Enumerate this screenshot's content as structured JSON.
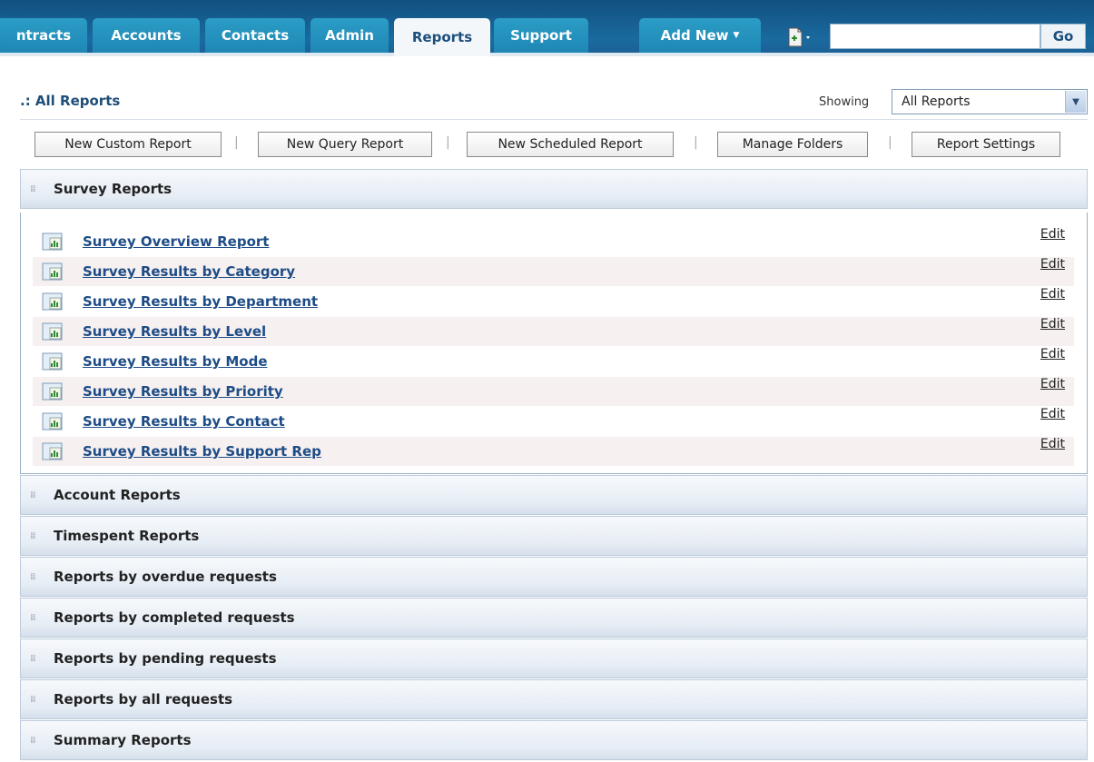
{
  "nav": {
    "tabs": [
      {
        "label": "ntracts"
      },
      {
        "label": "Accounts"
      },
      {
        "label": "Contacts"
      },
      {
        "label": "Admin"
      },
      {
        "label": "Reports",
        "active": true
      },
      {
        "label": "Support"
      }
    ],
    "add_new_label": "Add New",
    "quick_icon": "new-document-icon",
    "search_value": "",
    "go_label": "Go"
  },
  "header": {
    "title": ".: All Reports",
    "showing_label": "Showing",
    "showing_value": "All Reports"
  },
  "toolbar": {
    "buttons": [
      {
        "label": "New Custom Report"
      },
      {
        "label": "New Query Report"
      },
      {
        "label": "New Scheduled Report"
      },
      {
        "label": "Manage Folders"
      },
      {
        "label": "Report Settings"
      }
    ],
    "separator": "|"
  },
  "sections": [
    {
      "title": "Survey Reports",
      "expanded": true
    },
    {
      "title": "Account Reports"
    },
    {
      "title": "Timespent Reports"
    },
    {
      "title": "Reports by overdue requests"
    },
    {
      "title": "Reports by completed requests"
    },
    {
      "title": "Reports by pending requests"
    },
    {
      "title": "Reports by all requests"
    },
    {
      "title": "Summary Reports"
    }
  ],
  "survey_reports": [
    {
      "name": "Survey Overview Report",
      "edit": "Edit"
    },
    {
      "name": "Survey Results by Category",
      "edit": "Edit"
    },
    {
      "name": "Survey Results by Department",
      "edit": "Edit"
    },
    {
      "name": "Survey Results by Level",
      "edit": "Edit"
    },
    {
      "name": "Survey Results by Mode",
      "edit": "Edit"
    },
    {
      "name": "Survey Results by Priority",
      "edit": "Edit"
    },
    {
      "name": "Survey Results by Contact",
      "edit": "Edit"
    },
    {
      "name": "Survey Results by Support Rep",
      "edit": "Edit"
    }
  ],
  "colors": {
    "nav_bar": "#1c5f93",
    "tab": "#2393c0",
    "active_tab_text": "#1c4f7c",
    "link": "#1d4c86",
    "alt_row": "#f6f0f0"
  }
}
